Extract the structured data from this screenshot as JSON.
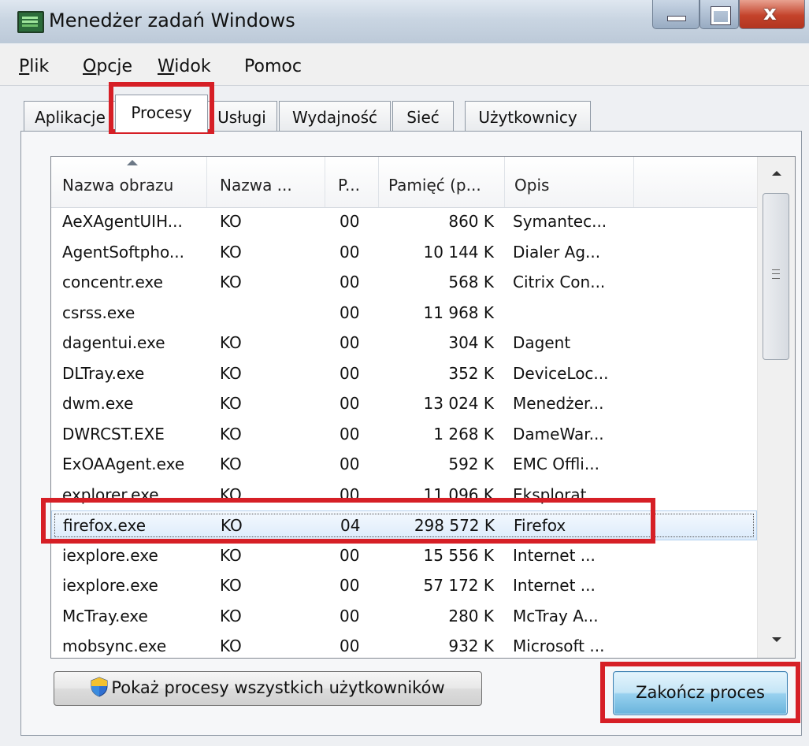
{
  "window": {
    "title": "Menedżer zadań Windows"
  },
  "menu": {
    "items": [
      "Plik",
      "Opcje",
      "Widok",
      "Pomoc"
    ]
  },
  "tabs": [
    {
      "label": "Aplikacje",
      "active": false
    },
    {
      "label": "Procesy",
      "active": true
    },
    {
      "label": "Usługi",
      "active": false
    },
    {
      "label": "Wydajność",
      "active": false
    },
    {
      "label": "Sieć",
      "active": false
    },
    {
      "label": "Użytkownicy",
      "active": false
    }
  ],
  "table": {
    "columns": [
      "Nazwa obrazu",
      "Nazwa ...",
      "P...",
      "Pamięć (p...",
      "Opis"
    ],
    "rows": [
      {
        "name": "AeXAgentUIH...",
        "user": "KO",
        "cpu": "00",
        "mem": "860 K",
        "desc": "Symantec..."
      },
      {
        "name": "AgentSoftpho...",
        "user": "KO",
        "cpu": "00",
        "mem": "10 144 K",
        "desc": "Dialer Ag..."
      },
      {
        "name": "concentr.exe",
        "user": "KO",
        "cpu": "00",
        "mem": "568 K",
        "desc": "Citrix Con..."
      },
      {
        "name": "csrss.exe",
        "user": "",
        "cpu": "00",
        "mem": "11 968 K",
        "desc": ""
      },
      {
        "name": "dagentui.exe",
        "user": "KO",
        "cpu": "00",
        "mem": "304 K",
        "desc": "Dagent"
      },
      {
        "name": "DLTray.exe",
        "user": "KO",
        "cpu": "00",
        "mem": "352 K",
        "desc": "DeviceLoc..."
      },
      {
        "name": "dwm.exe",
        "user": "KO",
        "cpu": "00",
        "mem": "13 024 K",
        "desc": "Menedżer..."
      },
      {
        "name": "DWRCST.EXE",
        "user": "KO",
        "cpu": "00",
        "mem": "1 268 K",
        "desc": "DameWar..."
      },
      {
        "name": "ExOAAgent.exe",
        "user": "KO",
        "cpu": "00",
        "mem": "592 K",
        "desc": "EMC Offli..."
      },
      {
        "name": "explorer.exe",
        "user": "KO",
        "cpu": "00",
        "mem": "11 096 K",
        "desc": "Eksplorat..."
      },
      {
        "name": "firefox.exe",
        "user": "KO",
        "cpu": "04",
        "mem": "298 572 K",
        "desc": "Firefox",
        "selected": true
      },
      {
        "name": "iexplore.exe",
        "user": "KO",
        "cpu": "00",
        "mem": "15 556 K",
        "desc": "Internet ..."
      },
      {
        "name": "iexplore.exe",
        "user": "KO",
        "cpu": "00",
        "mem": "57 172 K",
        "desc": "Internet ..."
      },
      {
        "name": "McTray.exe",
        "user": "KO",
        "cpu": "00",
        "mem": "280 K",
        "desc": "McTray A..."
      },
      {
        "name": "mobsync.exe",
        "user": "KO",
        "cpu": "00",
        "mem": "932 K",
        "desc": "Microsoft ..."
      }
    ]
  },
  "buttons": {
    "show_all": "Pokaż procesy wszystkich użytkowników",
    "end_process": "Zakończ proces"
  },
  "colors": {
    "highlight": "#d61f26",
    "selection": "#dcebfb"
  }
}
